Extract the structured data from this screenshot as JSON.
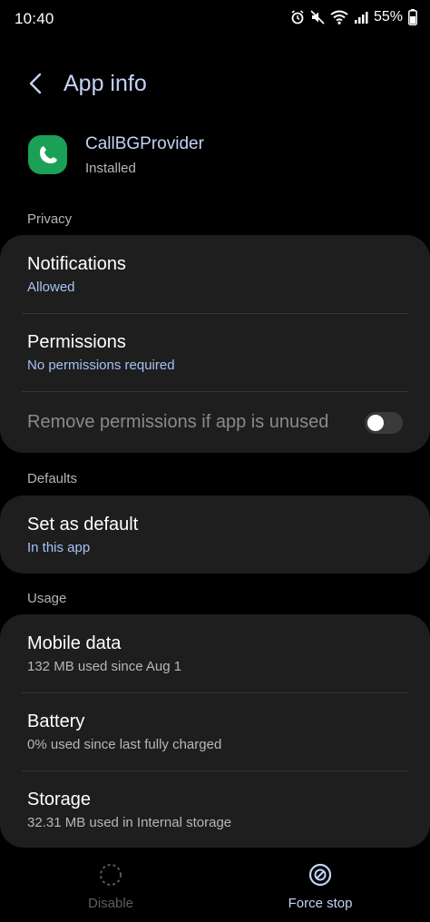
{
  "status_bar": {
    "time": "10:40",
    "battery": "55%"
  },
  "header": {
    "title": "App info"
  },
  "app": {
    "name": "CallBGProvider",
    "status": "Installed",
    "icon_color": "#1aa157"
  },
  "privacy": {
    "label": "Privacy",
    "notifications": {
      "title": "Notifications",
      "subtitle": "Allowed"
    },
    "permissions": {
      "title": "Permissions",
      "subtitle": "No permissions required"
    },
    "remove_unused": {
      "title": "Remove permissions if app is unused",
      "enabled": false
    }
  },
  "defaults": {
    "label": "Defaults",
    "set_default": {
      "title": "Set as default",
      "subtitle": "In this app"
    }
  },
  "usage": {
    "label": "Usage",
    "mobile_data": {
      "title": "Mobile data",
      "subtitle": "132 MB used since Aug 1"
    },
    "battery": {
      "title": "Battery",
      "subtitle": "0% used since last fully charged"
    },
    "storage": {
      "title": "Storage",
      "subtitle": "32.31 MB used in Internal storage"
    }
  },
  "bottom_bar": {
    "disable": "Disable",
    "force_stop": "Force stop"
  },
  "colors": {
    "accent_blue": "#a4c2f4",
    "title_blue": "#c3d3f6",
    "card": "#1e1e1e"
  }
}
